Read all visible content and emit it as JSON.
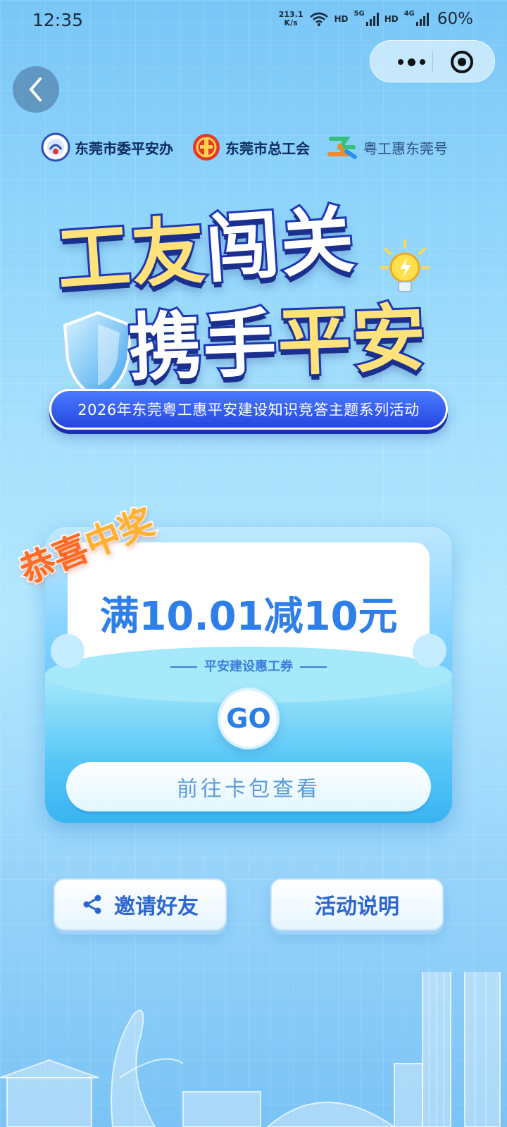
{
  "status_bar": {
    "time": "12:35",
    "speed_value": "213.1",
    "speed_unit": "K/s",
    "hd1": "HD",
    "net1": "5G",
    "hd2": "HD",
    "net2": "4G",
    "battery": "60%"
  },
  "organizers": [
    {
      "name": "东莞市委平安办",
      "icon": "peace-office-logo"
    },
    {
      "name": "东莞市总工会",
      "icon": "trade-union-logo"
    },
    {
      "name": "粤工惠东莞号",
      "icon": "yuegonghui-logo"
    }
  ],
  "title": {
    "line1_a": "工",
    "line1_b": "友",
    "line1_c": "闯关",
    "line2_a": "携手",
    "line2_b": "平安"
  },
  "subtitle": "2026年东莞粤工惠平安建设知识竞答主题系列活动",
  "prize": {
    "congrats_a": "恭喜",
    "congrats_b": "中奖",
    "amount": "满10.01减10元",
    "voucher_name": "平安建设惠工券",
    "go_label": "GO",
    "view_button": "前往卡包查看"
  },
  "actions": {
    "invite": "邀请好友",
    "rules": "活动说明"
  },
  "colors": {
    "accent_blue": "#2b65cf",
    "orange": "#ff6b24",
    "gold": "#ffe27a"
  }
}
